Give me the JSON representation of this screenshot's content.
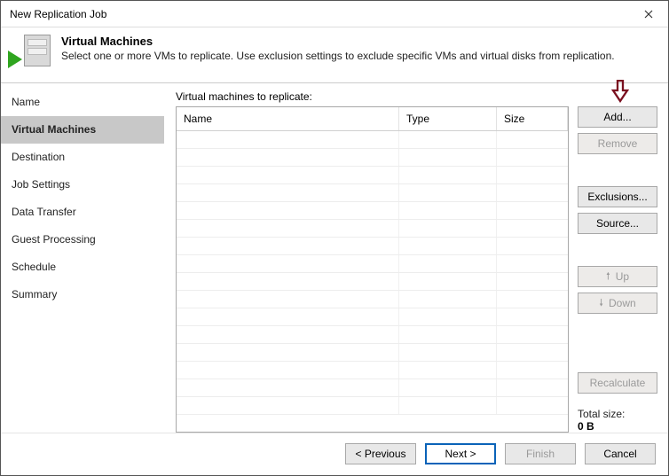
{
  "window": {
    "title": "New Replication Job"
  },
  "header": {
    "title": "Virtual Machines",
    "subtitle": "Select one or more VMs to replicate. Use exclusion settings to exclude specific VMs and virtual disks from replication."
  },
  "sidebar": {
    "items": [
      {
        "label": "Name"
      },
      {
        "label": "Virtual Machines"
      },
      {
        "label": "Destination"
      },
      {
        "label": "Job Settings"
      },
      {
        "label": "Data Transfer"
      },
      {
        "label": "Guest Processing"
      },
      {
        "label": "Schedule"
      },
      {
        "label": "Summary"
      }
    ],
    "active_index": 1
  },
  "main": {
    "list_label": "Virtual machines to replicate:",
    "columns": {
      "name": "Name",
      "type": "Type",
      "size": "Size"
    },
    "rows": []
  },
  "sidebuttons": {
    "add": "Add...",
    "remove": "Remove",
    "exclusions": "Exclusions...",
    "source": "Source...",
    "up": "Up",
    "down": "Down",
    "recalculate": "Recalculate"
  },
  "totals": {
    "label": "Total size:",
    "value": "0 B"
  },
  "footer": {
    "previous": "< Previous",
    "next": "Next >",
    "finish": "Finish",
    "cancel": "Cancel"
  }
}
